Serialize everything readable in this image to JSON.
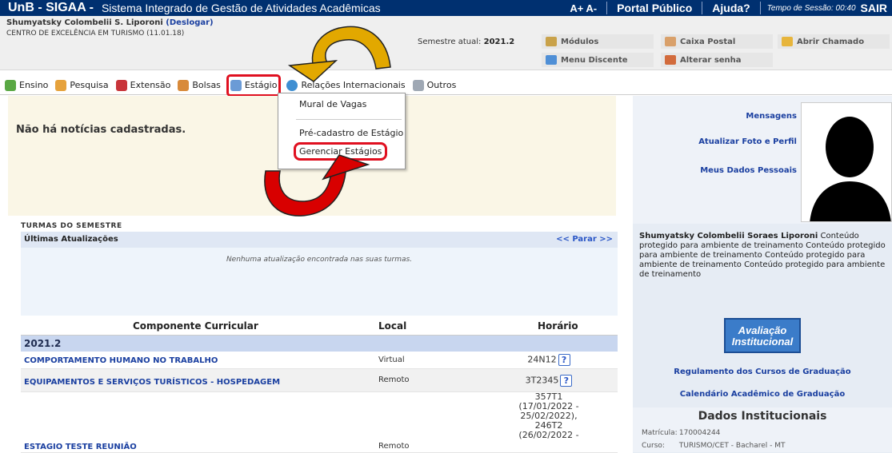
{
  "header": {
    "brand": "UnB - SIGAA -",
    "system_name": "Sistema Integrado de Gestão de Atividades Acadêmicas",
    "font_controls": "A+ A-",
    "portal_link": "Portal Público",
    "help_link": "Ajuda?",
    "session_text": "Tempo de Sessão: 00:40",
    "logout": "SAIR"
  },
  "user": {
    "name": "Shumyatsky Colombelii S. Liporoni",
    "logout_label": "(Deslogar)",
    "unit": "CENTRO DE EXCELÊNCIA EM TURISMO (11.01.18)",
    "semester_label": "Semestre atual:",
    "semester_value": "2021.2"
  },
  "quick_links": {
    "modules": "Módulos",
    "mailbox": "Caixa Postal",
    "open_ticket": "Abrir Chamado",
    "student_menu": "Menu Discente",
    "change_password": "Alterar senha"
  },
  "menu": {
    "items": [
      "Ensino",
      "Pesquisa",
      "Extensão",
      "Bolsas",
      "Estágio",
      "Relações Internacionais",
      "Outros"
    ]
  },
  "dropdown": {
    "items": [
      "Mural de Vagas",
      "Pré-cadastro de Estágio",
      "Gerenciar Estágios"
    ]
  },
  "news": {
    "message": "Não há notícias cadastradas."
  },
  "section": {
    "title": "TURMAS DO SEMESTRE"
  },
  "updates": {
    "title": "Últimas Atualizações",
    "stop": "<< Parar >>",
    "none": "Nenhuma atualização encontrada nas suas turmas."
  },
  "table": {
    "headers": [
      "Componente Curricular",
      "Local",
      "Horário"
    ],
    "semester": "2021.2",
    "rows": [
      {
        "name": "COMPORTAMENTO HUMANO NO TRABALHO",
        "local": "Virtual",
        "horario": "24N12"
      },
      {
        "name": "EQUIPAMENTOS E SERVIÇOS TURÍSTICOS - HOSPEDAGEM",
        "local": "Remoto",
        "horario": "3T2345"
      },
      {
        "name": "ESTAGIO TESTE REUNIÃO",
        "local": "Remoto",
        "horario_lines": [
          "357T1",
          "(17/01/2022 -",
          "25/02/2022),",
          "246T2",
          "(26/02/2022 -"
        ]
      }
    ]
  },
  "right_panel": {
    "messages": "Mensagens",
    "update_photo": "Atualizar Foto e Perfil",
    "my_data": "Meus Dados Pessoais",
    "user_full": "Shumyatsky Colombelii Soraes Liporoni",
    "description": "Conteúdo protegido para ambiente de treinamento Conteúdo protegido para ambiente de treinamento Conteúdo protegido para ambiente de treinamento Conteúdo protegido para ambiente de treinamento",
    "badge_line1": "Avaliação",
    "badge_line2": "Institucional",
    "reg_link": "Regulamento dos Cursos de Graduação",
    "cal_link": "Calendário Acadêmico de Graduação",
    "inst_title": "Dados Institucionais",
    "matricula_label": "Matrícula:",
    "matricula": "170004244",
    "curso_label": "Curso:",
    "curso": "TURISMO/CET - Bacharel - MT"
  },
  "colors": {
    "header_bg": "#003070",
    "highlight_red": "#e01020",
    "arrow_gold": "#e2a800",
    "arrow_red": "#d80000",
    "link_blue": "#1a3fa0"
  }
}
